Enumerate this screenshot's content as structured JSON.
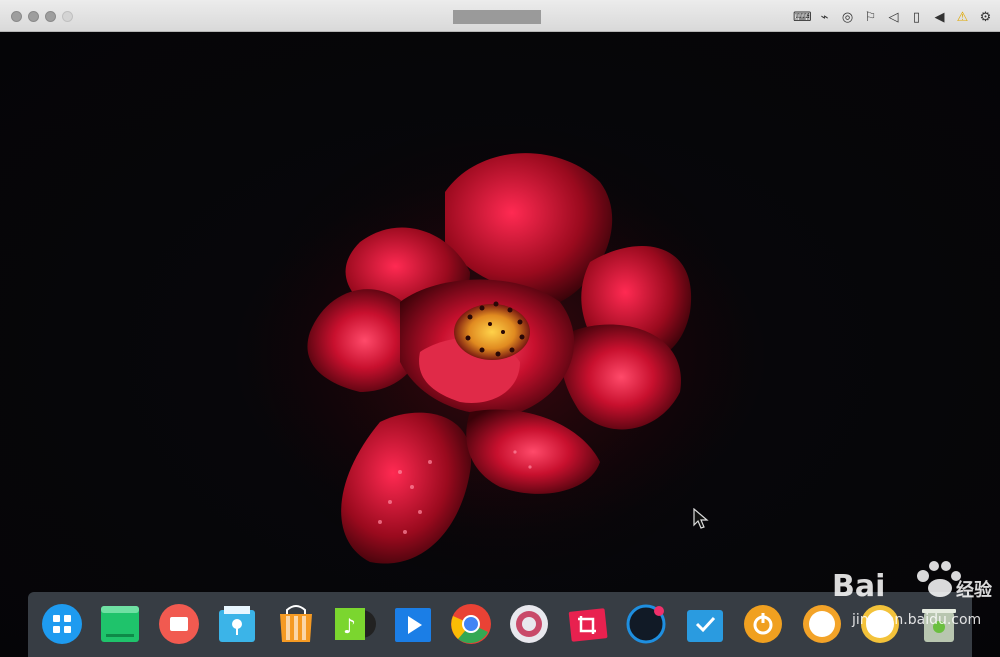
{
  "window": {
    "title": "",
    "tray_icons": [
      "keyboard-icon",
      "usb-icon",
      "disc-icon",
      "network-icon",
      "volume-icon",
      "device-icon",
      "back-icon",
      "warning-icon",
      "gear-icon"
    ]
  },
  "dock": {
    "apps": [
      {
        "name": "launcher-icon",
        "color": "#1e9bf0"
      },
      {
        "name": "deepin-terminal-icon",
        "color": "#1fc36b"
      },
      {
        "name": "video-icon",
        "color": "#f15a50"
      },
      {
        "name": "file-manager-icon",
        "color": "#3bb4e8"
      },
      {
        "name": "app-store-icon",
        "color": "#f59a23"
      },
      {
        "name": "music-icon",
        "color": "#7bd62f"
      },
      {
        "name": "movie-player-icon",
        "color": "#1b7ee6"
      },
      {
        "name": "chrome-icon",
        "color": "#e94235"
      },
      {
        "name": "settings-icon",
        "color": "#e8e8ee"
      },
      {
        "name": "screenshot-icon",
        "color": "#e8214f"
      },
      {
        "name": "monitor-icon",
        "color": "#1e8fe0"
      },
      {
        "name": "deepin-backup-icon",
        "color": "#2a9be0"
      },
      {
        "name": "power-icon",
        "color": "#f0a020"
      },
      {
        "name": "clock-icon",
        "color": "#f3a328"
      },
      {
        "name": "calendar-icon",
        "color": "#f3c23a"
      },
      {
        "name": "trash-icon",
        "color": "#b8c6b0"
      }
    ]
  },
  "watermark": {
    "brand": "Bai",
    "brand_cn": "经验",
    "url": "jingyan.baidu.com"
  }
}
